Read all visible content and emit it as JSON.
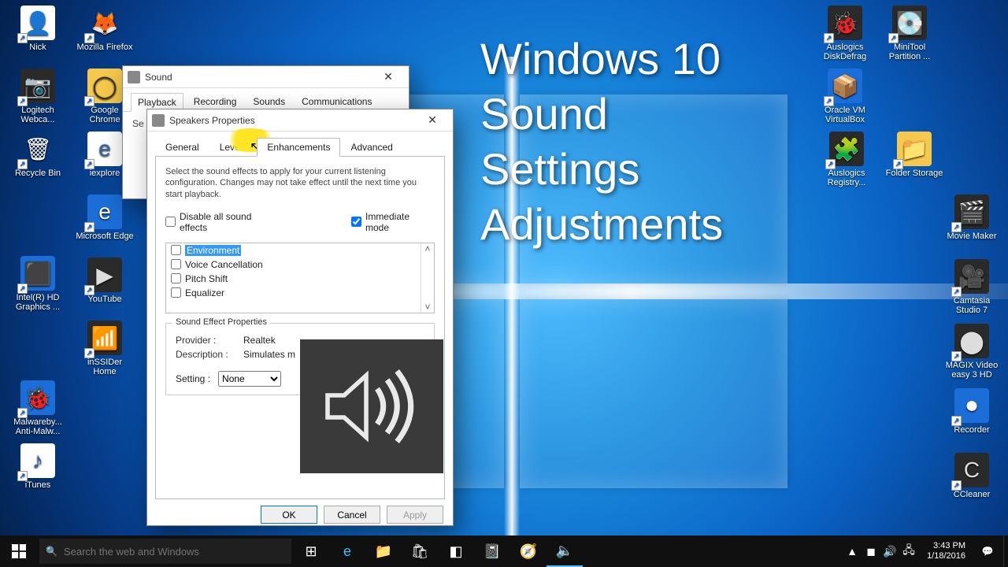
{
  "overlay_title": "Windows 10\nSound\nSettings\nAdjustments",
  "desktop_icons_left": [
    {
      "label": "Nick",
      "glyph": "👤",
      "cls": "bg-w"
    },
    {
      "label": "Logitech Webca...",
      "glyph": "📷",
      "cls": "bg-d"
    },
    {
      "label": "Recycle Bin",
      "glyph": "🗑",
      "cls": ""
    },
    {
      "label": "",
      "glyph": "",
      "cls": ""
    },
    {
      "label": "Intel(R) HD Graphics ...",
      "glyph": "⬛",
      "cls": "bg-b"
    },
    {
      "label": "",
      "glyph": "",
      "cls": ""
    },
    {
      "label": "Malwareby... Anti-Malw...",
      "glyph": "🐞",
      "cls": "bg-b"
    },
    {
      "label": "iTunes",
      "glyph": "♪",
      "cls": "bg-w"
    },
    {
      "label": "Mozilla Firefox",
      "glyph": "🦊",
      "cls": ""
    },
    {
      "label": "Google Chrome",
      "glyph": "◯",
      "cls": "bg-y"
    },
    {
      "label": "iexplore",
      "glyph": "e",
      "cls": "bg-w"
    },
    {
      "label": "Microsoft Edge",
      "glyph": "e",
      "cls": "bg-b"
    },
    {
      "label": "YouTube",
      "glyph": "▶",
      "cls": "bg-d"
    },
    {
      "label": "inSSIDer Home",
      "glyph": "📶",
      "cls": "bg-d"
    }
  ],
  "desktop_icons_right": [
    {
      "label": "Auslogics DiskDefrag",
      "glyph": "🐞",
      "cls": "bg-d"
    },
    {
      "label": "MiniTool Partition ...",
      "glyph": "💽",
      "cls": "bg-d"
    },
    {
      "label": "Oracle VM VirtualBox",
      "glyph": "📦",
      "cls": "bg-b"
    },
    {
      "label": "Auslogics Registry...",
      "glyph": "🧩",
      "cls": "bg-d"
    },
    {
      "label": "Folder Storage",
      "glyph": "📁",
      "cls": "bg-y"
    },
    {
      "label": "Movie Maker",
      "glyph": "🎬",
      "cls": "bg-d"
    },
    {
      "label": "Camtasia Studio 7",
      "glyph": "🎥",
      "cls": "bg-d"
    },
    {
      "label": "MAGIX Video easy 3 HD",
      "glyph": "⬤",
      "cls": "bg-d"
    },
    {
      "label": "Recorder",
      "glyph": "⏺",
      "cls": "bg-b"
    },
    {
      "label": "CCleaner",
      "glyph": "C",
      "cls": "bg-d"
    }
  ],
  "sound_window": {
    "title": "Sound",
    "tabs": [
      "Playback",
      "Recording",
      "Sounds",
      "Communications"
    ],
    "active_tab": "Playback"
  },
  "props_window": {
    "title": "Speakers Properties",
    "tabs": [
      "General",
      "Levels",
      "Enhancements",
      "Advanced"
    ],
    "active_tab": "Enhancements",
    "description": "Select the sound effects to apply for your current listening configuration. Changes may not take effect until the next time you start playback.",
    "disable_all": "Disable all sound effects",
    "immediate": "Immediate mode",
    "effects": [
      "Environment",
      "Voice Cancellation",
      "Pitch Shift",
      "Equalizer"
    ],
    "selected_effect": "Environment",
    "group_title": "Sound Effect Properties",
    "provider_label": "Provider :",
    "provider_value": "Realtek",
    "description_label": "Description :",
    "description_value": "Simulates m",
    "setting_label": "Setting :",
    "setting_value": "None",
    "buttons": {
      "ok": "OK",
      "cancel": "Cancel",
      "apply": "Apply"
    }
  },
  "taskbar": {
    "search_placeholder": "Search the web and Windows",
    "tray_icons": [
      "▲",
      "◼",
      "🔊",
      "🖧"
    ],
    "time": "3:43 PM",
    "date": "1/18/2016"
  }
}
